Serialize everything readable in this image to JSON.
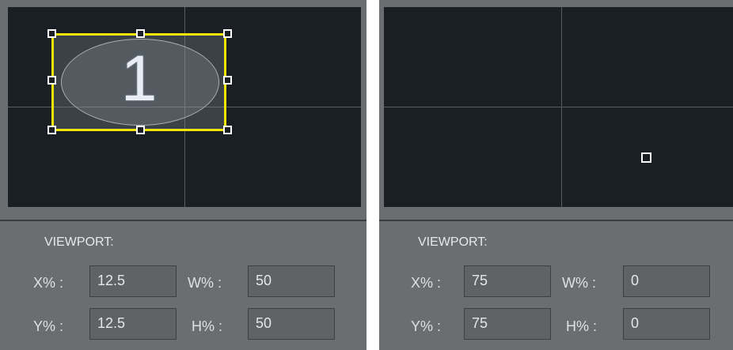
{
  "left_panel": {
    "region_number": "1",
    "viewport_label": "VIEWPORT:",
    "x_label": "X% :",
    "y_label": "Y% :",
    "w_label": "W% :",
    "h_label": "H% :",
    "x_value": "12.5",
    "y_value": "12.5",
    "w_value": "50",
    "h_value": "50"
  },
  "right_panel": {
    "viewport_label": "VIEWPORT:",
    "x_label": "X% :",
    "y_label": "Y% :",
    "w_label": "W% :",
    "h_label": "H% :",
    "x_value": "75",
    "y_value": "75",
    "w_value": "0",
    "h_value": "0"
  },
  "colors": {
    "selection_border": "#f2e600",
    "canvas_background": "#1a1f25",
    "panel_background": "#6a6e70"
  }
}
